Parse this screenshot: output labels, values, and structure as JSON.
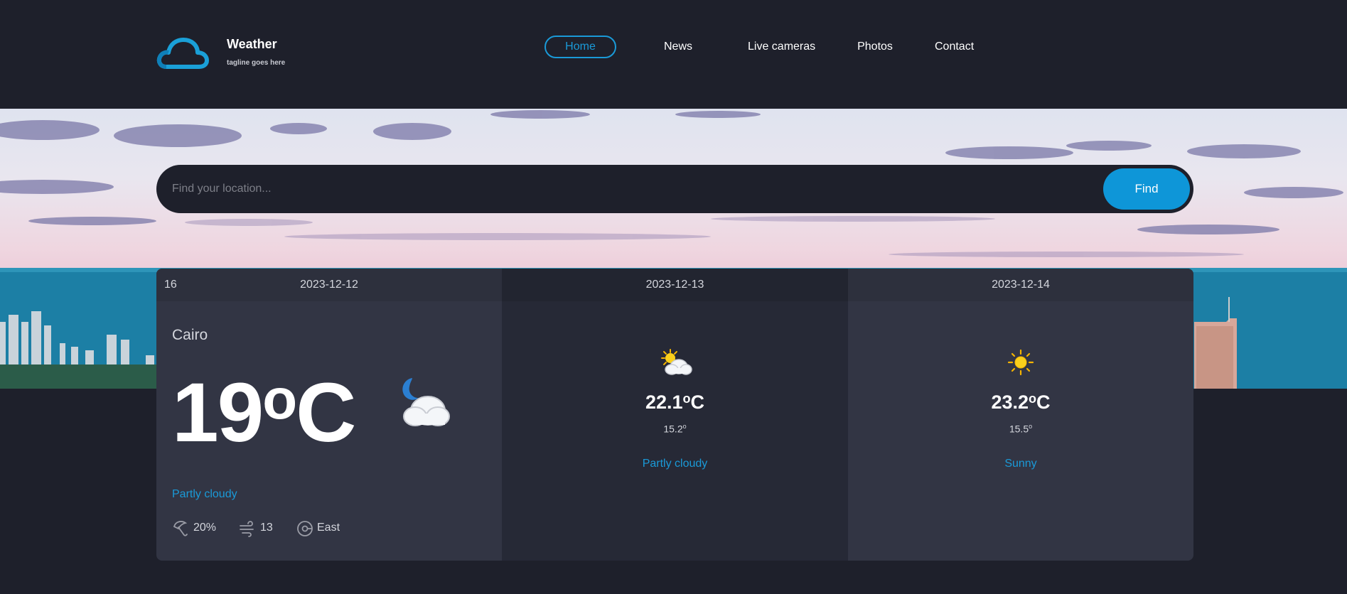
{
  "brand": {
    "title": "Weather",
    "tagline": "tagline goes here",
    "accent": "#1a9ad8"
  },
  "nav": {
    "items": [
      {
        "label": "Home",
        "active": true
      },
      {
        "label": "News"
      },
      {
        "label": "Live cameras"
      },
      {
        "label": "Photos"
      },
      {
        "label": "Contact"
      }
    ]
  },
  "search": {
    "placeholder": "Find your location...",
    "value": "",
    "button_label": "Find"
  },
  "forecast": {
    "current": {
      "day": "16",
      "date": "2023-12-12",
      "city": "Cairo",
      "temp": "19",
      "unit": "C",
      "icon": "night-partly-cloudy-icon",
      "condition": "Partly cloudy",
      "rain": "20%",
      "wind_speed": "13",
      "wind_dir": "East"
    },
    "days": [
      {
        "date": "2023-12-13",
        "icon": "partly-cloudy-icon",
        "max": "22.1",
        "unit": "C",
        "min": "15.2",
        "condition": "Partly cloudy"
      },
      {
        "date": "2023-12-14",
        "icon": "sunny-icon",
        "max": "23.2",
        "unit": "C",
        "min": "15.5",
        "condition": "Sunny"
      }
    ]
  },
  "colors": {
    "background": "#1e202b",
    "panel": "#323544",
    "panel_alt": "#262936",
    "button": "#0e96d8"
  }
}
